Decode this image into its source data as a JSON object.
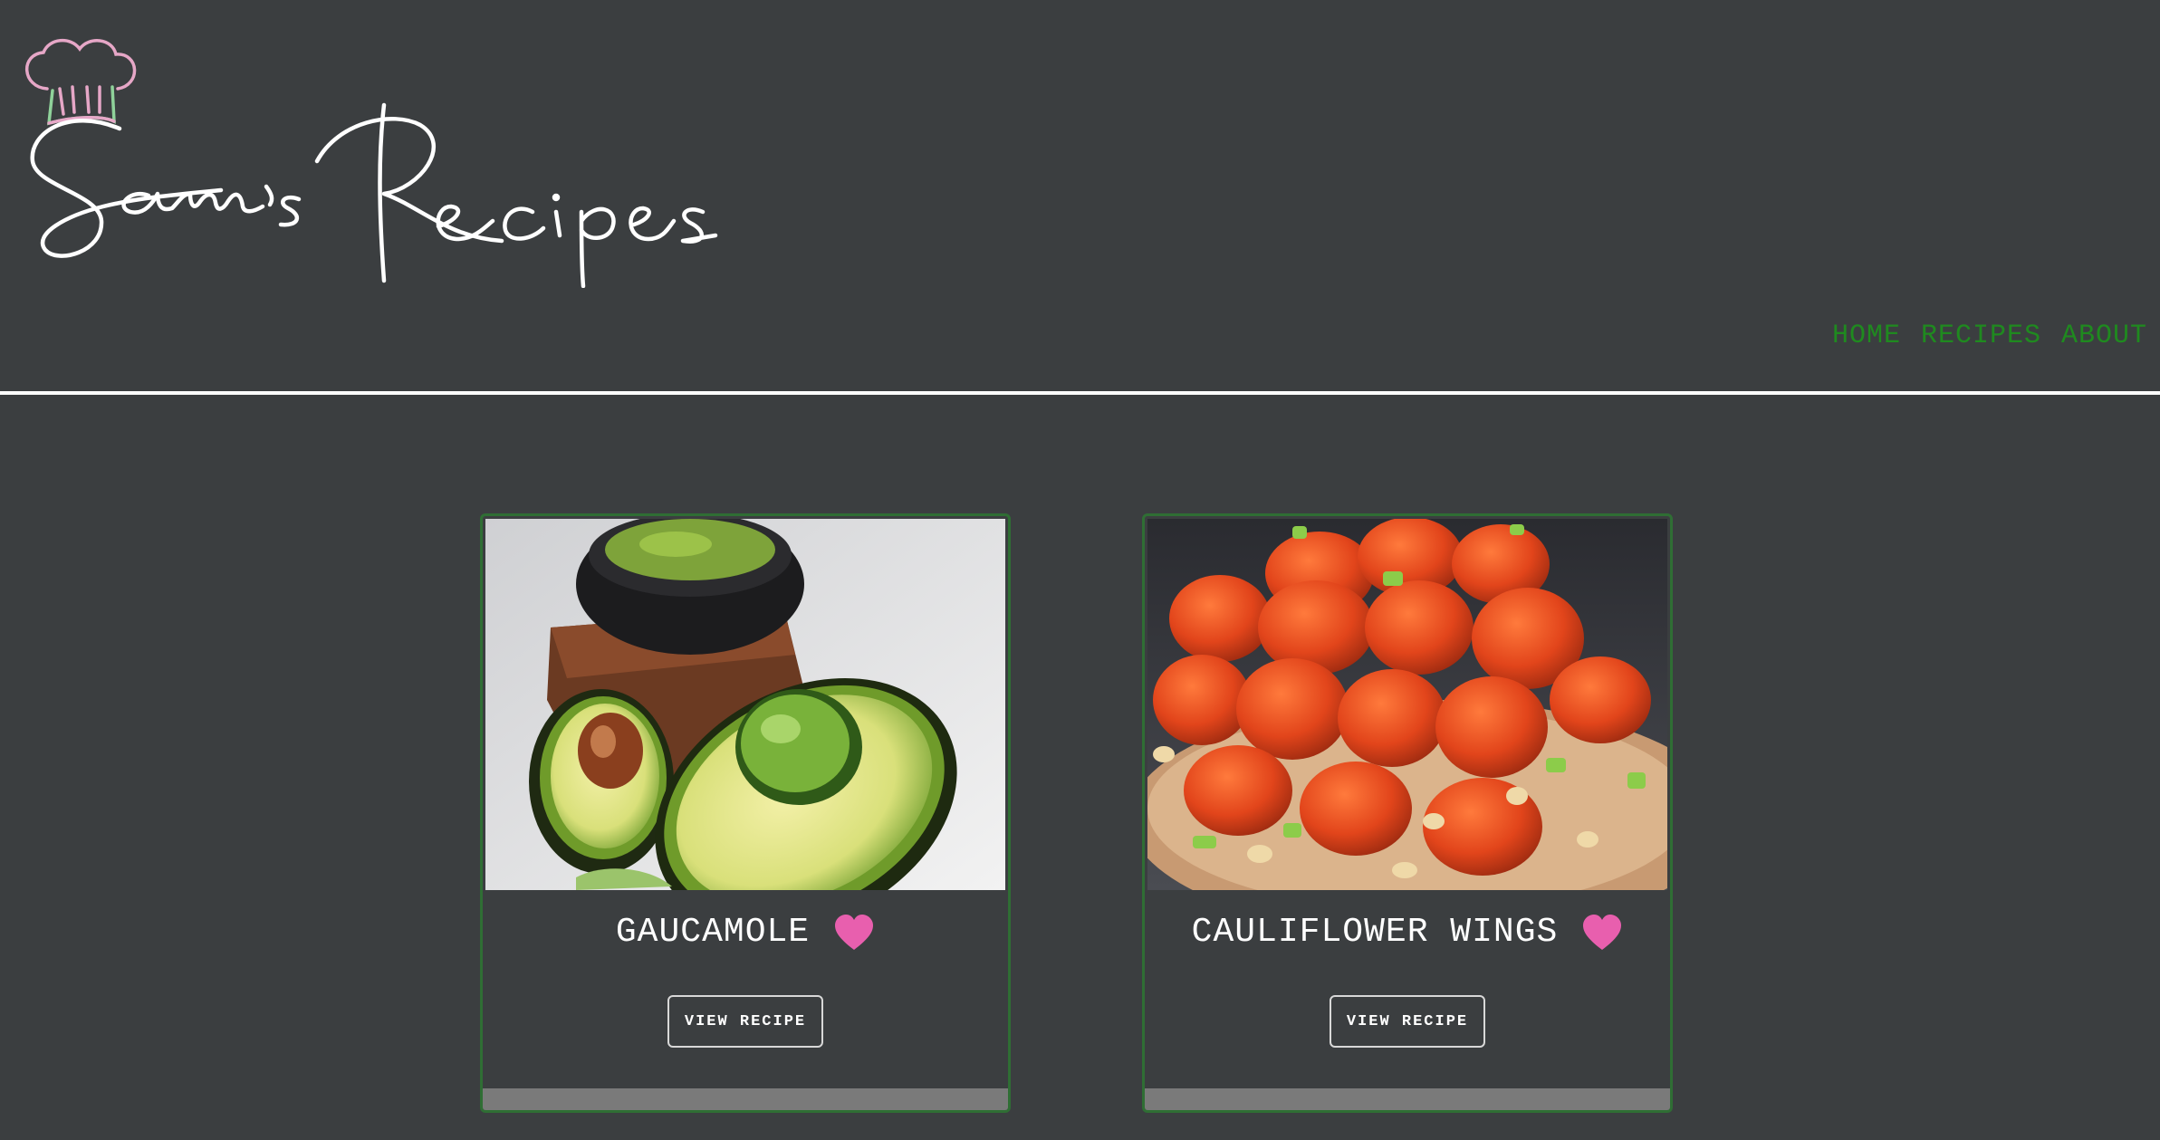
{
  "site": {
    "logo_text": "Sam's Recipes"
  },
  "nav": {
    "items": [
      {
        "label": "HOME"
      },
      {
        "label": "RECIPES"
      },
      {
        "label": "ABOUT"
      }
    ]
  },
  "recipes": [
    {
      "title": "GAUCAMOLE",
      "button_label": "VIEW RECIPE",
      "image": "guacamole-with-avocados",
      "favorite_icon": "heart-icon"
    },
    {
      "title": "CAULIFLOWER WINGS",
      "button_label": "VIEW RECIPE",
      "image": "cauliflower-wings",
      "favorite_icon": "heart-icon"
    }
  ],
  "colors": {
    "background": "#3b3e40",
    "nav_link": "#1f8a1f",
    "heart": "#e85fae",
    "card_border": "#2f6e34",
    "divider": "#ffffff"
  }
}
